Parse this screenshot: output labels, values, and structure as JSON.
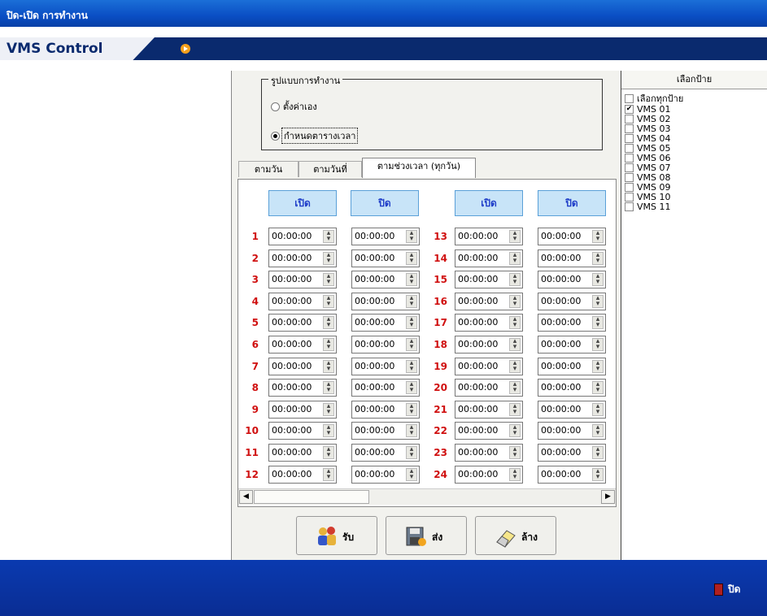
{
  "window": {
    "title": "ปิด-เปิด การทำงาน"
  },
  "brand": {
    "name": "VMS Control"
  },
  "mode": {
    "legend": "รูปแบบการทำงาน",
    "options": [
      {
        "label": "ตั้งค่าเอง",
        "selected": false
      },
      {
        "label": "กำหนดตารางเวลา",
        "selected": true
      }
    ]
  },
  "tabs": [
    {
      "label": "ตามวัน",
      "active": false
    },
    {
      "label": "ตามวันที่",
      "active": false
    },
    {
      "label": "ตามช่วงเวลา (ทุกวัน)",
      "active": true
    }
  ],
  "schedule": {
    "headers": [
      "เปิด",
      "ปิด",
      "เปิด",
      "ปิด"
    ],
    "left_rows": [
      1,
      2,
      3,
      4,
      5,
      6,
      7,
      8,
      9,
      10,
      11,
      12
    ],
    "right_rows": [
      13,
      14,
      15,
      16,
      17,
      18,
      19,
      20,
      21,
      22,
      23,
      24
    ],
    "default_time": "00:00:00"
  },
  "actions": {
    "receive": "รับ",
    "send": "ส่ง",
    "clear": "ล้าง"
  },
  "signs": {
    "title": "เลือกป้าย",
    "select_all": "เลือกทุกป้าย",
    "items": [
      {
        "label": "VMS 01",
        "checked": true
      },
      {
        "label": "VMS 02",
        "checked": false
      },
      {
        "label": "VMS 03",
        "checked": false
      },
      {
        "label": "VMS 04",
        "checked": false
      },
      {
        "label": "VMS 05",
        "checked": false
      },
      {
        "label": "VMS 06",
        "checked": false
      },
      {
        "label": "VMS 07",
        "checked": false
      },
      {
        "label": "VMS 08",
        "checked": false
      },
      {
        "label": "VMS 09",
        "checked": false
      },
      {
        "label": "VMS 10",
        "checked": false
      },
      {
        "label": "VMS 11",
        "checked": false
      }
    ]
  },
  "footer": {
    "exit_label": "ปิด"
  },
  "colors": {
    "title_bar": "#0a4ec4",
    "brand_bar": "#0a2a6e",
    "footer": "#0a2d93",
    "header_fill": "#c8e4f8",
    "header_text": "#1e3cc8",
    "row_number": "#d01010"
  }
}
